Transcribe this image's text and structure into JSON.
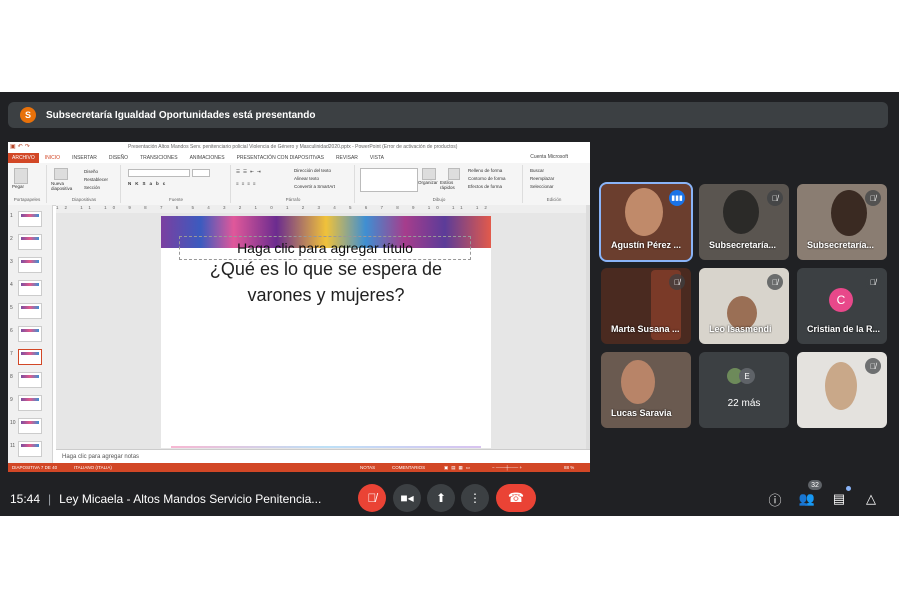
{
  "banner": {
    "avatar_letter": "S",
    "text": "Subsecretaría Igualdad Oportunidades está presentando"
  },
  "ppt": {
    "window_title": "Presentación Altos Mandos Serv. penitenciario policial Violencia de Género y Masculinidad2020.pptx - PowerPoint (Error de activación de productos)",
    "account": "Cuenta Microsoft",
    "tabs": [
      "ARCHIVO",
      "INICIO",
      "INSERTAR",
      "DISEÑO",
      "TRANSICIONES",
      "ANIMACIONES",
      "PRESENTACIÓN CON DIAPOSITIVAS",
      "REVISAR",
      "VISTA"
    ],
    "ribbon": {
      "paste": "Pegar",
      "new_slide": "Nueva diapositiva",
      "design": "Diseño",
      "reset": "Restablecer",
      "section": "Sección",
      "text_direction": "Dirección del texto",
      "align_text": "Alinear texto",
      "smartart": "Convertir a SmartArt",
      "arrange": "Organizar",
      "quick_styles": "Estilos rápidos",
      "shape_fill": "Relleno de forma",
      "shape_outline": "Contorno de forma",
      "shape_effects": "Efectos de forma",
      "find": "Buscar",
      "replace": "Reemplazar",
      "select": "Seleccionar",
      "groups": [
        "Portapapeles",
        "Diapositivas",
        "Fuente",
        "Párrafo",
        "Dibujo",
        "Edición"
      ]
    },
    "thumb_numbers": [
      "1",
      "2",
      "3",
      "4",
      "5",
      "6",
      "7",
      "8",
      "9",
      "10",
      "11"
    ],
    "ruler": "12 11 10 9 8 7 6 5 4 3 2 1 0 1 2 3 4 5 6 7 8 9 10 11 12",
    "slide": {
      "placeholder": "Haga clic para agregar título",
      "question_line1": "¿Qué es lo que se espera de",
      "question_line2": "varones y mujeres?"
    },
    "notes": "Haga clic para agregar notas",
    "status": {
      "slide": "DIAPOSITIVA 7 DE 40",
      "lang": "ITALIANO (ITALIA)",
      "notes": "NOTAS",
      "comments": "COMENTARIOS",
      "zoom": "88 %"
    }
  },
  "participants": [
    {
      "name": "Agustín Pérez ...",
      "speaking": true
    },
    {
      "name": "Subsecretaría...",
      "muted": true
    },
    {
      "name": "Subsecretaría...",
      "muted": true
    },
    {
      "name": "Marta Susana ...",
      "muted": true
    },
    {
      "name": "Leo Isasmendi",
      "muted": true
    },
    {
      "name": "Cristian de la R...",
      "muted": true,
      "avatar_letter": "C"
    },
    {
      "name": "Lucas Saravia"
    },
    {
      "more_letter": "E",
      "more_label": "22 más"
    },
    {
      "name": "",
      "muted": true
    }
  ],
  "bottom": {
    "time": "15:44",
    "meeting_title": "Ley Micaela - Altos Mandos Servicio Penitencia...",
    "people_count": "32"
  },
  "colors": {
    "meet_bg": "#202124",
    "end_red": "#ea4335",
    "ppt_orange": "#d24726"
  }
}
